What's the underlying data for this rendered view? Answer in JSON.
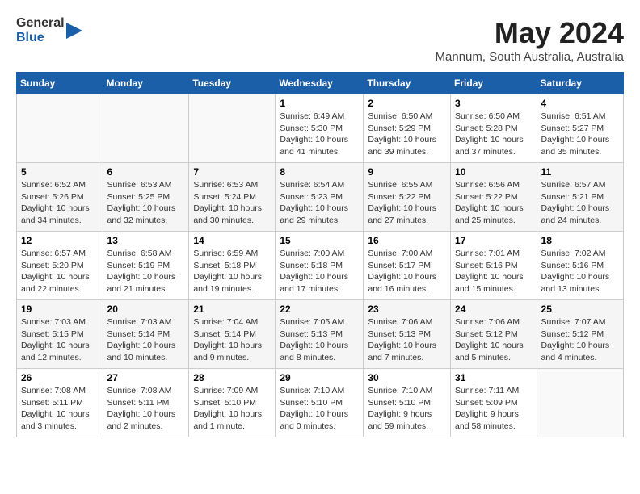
{
  "header": {
    "logo_general": "General",
    "logo_blue": "Blue",
    "month_year": "May 2024",
    "location": "Mannum, South Australia, Australia"
  },
  "days_of_week": [
    "Sunday",
    "Monday",
    "Tuesday",
    "Wednesday",
    "Thursday",
    "Friday",
    "Saturday"
  ],
  "weeks": [
    [
      {
        "day": "",
        "info": ""
      },
      {
        "day": "",
        "info": ""
      },
      {
        "day": "",
        "info": ""
      },
      {
        "day": "1",
        "info": "Sunrise: 6:49 AM\nSunset: 5:30 PM\nDaylight: 10 hours\nand 41 minutes."
      },
      {
        "day": "2",
        "info": "Sunrise: 6:50 AM\nSunset: 5:29 PM\nDaylight: 10 hours\nand 39 minutes."
      },
      {
        "day": "3",
        "info": "Sunrise: 6:50 AM\nSunset: 5:28 PM\nDaylight: 10 hours\nand 37 minutes."
      },
      {
        "day": "4",
        "info": "Sunrise: 6:51 AM\nSunset: 5:27 PM\nDaylight: 10 hours\nand 35 minutes."
      }
    ],
    [
      {
        "day": "5",
        "info": "Sunrise: 6:52 AM\nSunset: 5:26 PM\nDaylight: 10 hours\nand 34 minutes."
      },
      {
        "day": "6",
        "info": "Sunrise: 6:53 AM\nSunset: 5:25 PM\nDaylight: 10 hours\nand 32 minutes."
      },
      {
        "day": "7",
        "info": "Sunrise: 6:53 AM\nSunset: 5:24 PM\nDaylight: 10 hours\nand 30 minutes."
      },
      {
        "day": "8",
        "info": "Sunrise: 6:54 AM\nSunset: 5:23 PM\nDaylight: 10 hours\nand 29 minutes."
      },
      {
        "day": "9",
        "info": "Sunrise: 6:55 AM\nSunset: 5:22 PM\nDaylight: 10 hours\nand 27 minutes."
      },
      {
        "day": "10",
        "info": "Sunrise: 6:56 AM\nSunset: 5:22 PM\nDaylight: 10 hours\nand 25 minutes."
      },
      {
        "day": "11",
        "info": "Sunrise: 6:57 AM\nSunset: 5:21 PM\nDaylight: 10 hours\nand 24 minutes."
      }
    ],
    [
      {
        "day": "12",
        "info": "Sunrise: 6:57 AM\nSunset: 5:20 PM\nDaylight: 10 hours\nand 22 minutes."
      },
      {
        "day": "13",
        "info": "Sunrise: 6:58 AM\nSunset: 5:19 PM\nDaylight: 10 hours\nand 21 minutes."
      },
      {
        "day": "14",
        "info": "Sunrise: 6:59 AM\nSunset: 5:18 PM\nDaylight: 10 hours\nand 19 minutes."
      },
      {
        "day": "15",
        "info": "Sunrise: 7:00 AM\nSunset: 5:18 PM\nDaylight: 10 hours\nand 17 minutes."
      },
      {
        "day": "16",
        "info": "Sunrise: 7:00 AM\nSunset: 5:17 PM\nDaylight: 10 hours\nand 16 minutes."
      },
      {
        "day": "17",
        "info": "Sunrise: 7:01 AM\nSunset: 5:16 PM\nDaylight: 10 hours\nand 15 minutes."
      },
      {
        "day": "18",
        "info": "Sunrise: 7:02 AM\nSunset: 5:16 PM\nDaylight: 10 hours\nand 13 minutes."
      }
    ],
    [
      {
        "day": "19",
        "info": "Sunrise: 7:03 AM\nSunset: 5:15 PM\nDaylight: 10 hours\nand 12 minutes."
      },
      {
        "day": "20",
        "info": "Sunrise: 7:03 AM\nSunset: 5:14 PM\nDaylight: 10 hours\nand 10 minutes."
      },
      {
        "day": "21",
        "info": "Sunrise: 7:04 AM\nSunset: 5:14 PM\nDaylight: 10 hours\nand 9 minutes."
      },
      {
        "day": "22",
        "info": "Sunrise: 7:05 AM\nSunset: 5:13 PM\nDaylight: 10 hours\nand 8 minutes."
      },
      {
        "day": "23",
        "info": "Sunrise: 7:06 AM\nSunset: 5:13 PM\nDaylight: 10 hours\nand 7 minutes."
      },
      {
        "day": "24",
        "info": "Sunrise: 7:06 AM\nSunset: 5:12 PM\nDaylight: 10 hours\nand 5 minutes."
      },
      {
        "day": "25",
        "info": "Sunrise: 7:07 AM\nSunset: 5:12 PM\nDaylight: 10 hours\nand 4 minutes."
      }
    ],
    [
      {
        "day": "26",
        "info": "Sunrise: 7:08 AM\nSunset: 5:11 PM\nDaylight: 10 hours\nand 3 minutes."
      },
      {
        "day": "27",
        "info": "Sunrise: 7:08 AM\nSunset: 5:11 PM\nDaylight: 10 hours\nand 2 minutes."
      },
      {
        "day": "28",
        "info": "Sunrise: 7:09 AM\nSunset: 5:10 PM\nDaylight: 10 hours\nand 1 minute."
      },
      {
        "day": "29",
        "info": "Sunrise: 7:10 AM\nSunset: 5:10 PM\nDaylight: 10 hours\nand 0 minutes."
      },
      {
        "day": "30",
        "info": "Sunrise: 7:10 AM\nSunset: 5:10 PM\nDaylight: 9 hours\nand 59 minutes."
      },
      {
        "day": "31",
        "info": "Sunrise: 7:11 AM\nSunset: 5:09 PM\nDaylight: 9 hours\nand 58 minutes."
      },
      {
        "day": "",
        "info": ""
      }
    ]
  ]
}
